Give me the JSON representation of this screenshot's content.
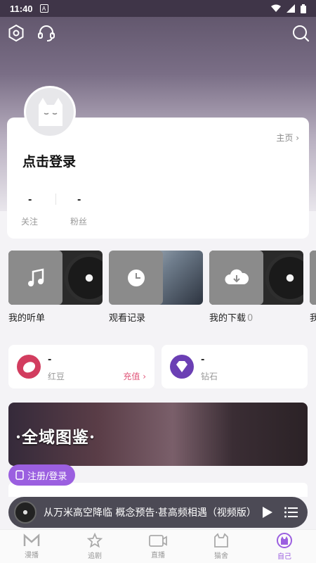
{
  "status_bar": {
    "time": "11:40",
    "app_badge": "A"
  },
  "profile": {
    "homepage_label": "主页",
    "login_prompt": "点击登录",
    "stats": [
      {
        "value": "-",
        "label": "关注"
      },
      {
        "value": "-",
        "label": "粉丝"
      }
    ]
  },
  "tiles": [
    {
      "label": "我的听单",
      "count": "",
      "icon": "music-note-icon"
    },
    {
      "label": "观看记录",
      "count": "",
      "icon": "clock-icon"
    },
    {
      "label": "我的下载",
      "count": "0",
      "icon": "cloud-download-icon"
    },
    {
      "label": "我",
      "count": "",
      "icon": ""
    }
  ],
  "wallet": {
    "red_bean": {
      "value": "-",
      "name": "红豆",
      "action": "充值"
    },
    "diamond": {
      "value": "-",
      "name": "钻石"
    }
  },
  "banner": {
    "title": "·全域图鉴·"
  },
  "register_button": "注册/登录",
  "player": {
    "now_playing": "从万米高空降临 概念预告·甚高频相遇（视频版）"
  },
  "tabs": [
    {
      "label": "漫播",
      "icon": "manbo-logo-icon"
    },
    {
      "label": "追剧",
      "icon": "star-icon"
    },
    {
      "label": "直播",
      "icon": "live-icon"
    },
    {
      "label": "猫舍",
      "icon": "cat-icon"
    },
    {
      "label": "自己",
      "icon": "self-avatar-icon",
      "active": true
    }
  ],
  "colors": {
    "accent": "#9b5fe0",
    "recharge": "#e0577a",
    "hero_top": "#5c5167"
  }
}
